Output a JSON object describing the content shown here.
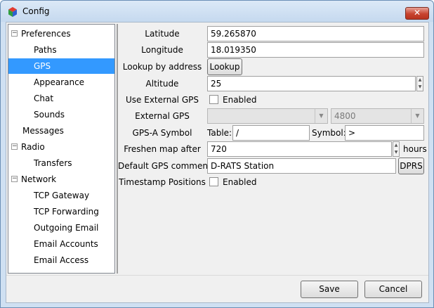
{
  "window": {
    "title": "Config",
    "close_label": "✕"
  },
  "tree": {
    "items": [
      {
        "label": "Preferences",
        "expander": "⊟"
      },
      {
        "label": "Paths"
      },
      {
        "label": "GPS"
      },
      {
        "label": "Appearance"
      },
      {
        "label": "Chat"
      },
      {
        "label": "Sounds"
      },
      {
        "label": "Messages"
      },
      {
        "label": "Radio",
        "expander": "⊟"
      },
      {
        "label": "Transfers"
      },
      {
        "label": "Network",
        "expander": "⊟"
      },
      {
        "label": "TCP Gateway"
      },
      {
        "label": "TCP Forwarding"
      },
      {
        "label": "Outgoing Email"
      },
      {
        "label": "Email Accounts"
      },
      {
        "label": "Email Access"
      }
    ],
    "selected": "GPS"
  },
  "form": {
    "latitude": {
      "label": "Latitude",
      "value": "59.265870"
    },
    "longitude": {
      "label": "Longitude",
      "value": "18.019350"
    },
    "lookup": {
      "label": "Lookup by address",
      "button": "Lookup"
    },
    "altitude": {
      "label": "Altitude",
      "value": "25"
    },
    "use_external_gps": {
      "label": "Use External GPS",
      "check_label": "Enabled",
      "checked": false
    },
    "external_gps": {
      "label": "External GPS",
      "port": "",
      "baud": "4800"
    },
    "gps_symbol": {
      "label": "GPS-A Symbol",
      "table_label": "Table:",
      "table_value": "/",
      "symbol_label": "Symbol:",
      "symbol_value": ">"
    },
    "freshen": {
      "label": "Freshen map after",
      "value": "720",
      "unit": "hours"
    },
    "gps_comment": {
      "label": "Default GPS comment",
      "value": "D-RATS Station",
      "button": "DPRS"
    },
    "timestamp": {
      "label": "Timestamp Positions",
      "check_label": "Enabled",
      "checked": false
    }
  },
  "buttons": {
    "save": "Save",
    "cancel": "Cancel"
  }
}
